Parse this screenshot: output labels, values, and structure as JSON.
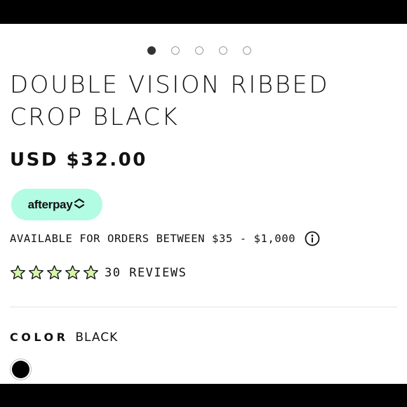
{
  "carousel": {
    "dot_count": 5,
    "active_index": 0
  },
  "product": {
    "title": "DOUBLE VISION RIBBED CROP BLACK",
    "price": "USD $32.00"
  },
  "afterpay": {
    "label": "afterpay",
    "badge_color": "#b2fce4",
    "availability": "AVAILABLE FOR ORDERS BETWEEN $35 - $1,000",
    "info_icon": "info-icon"
  },
  "reviews": {
    "rating": 5,
    "max": 5,
    "star_fill": "#d4f7a6",
    "label": "30 REVIEWS"
  },
  "color": {
    "label": "COLOR",
    "value": "BLACK",
    "swatches": [
      {
        "name": "BLACK",
        "hex": "#000000",
        "selected": true
      }
    ]
  }
}
